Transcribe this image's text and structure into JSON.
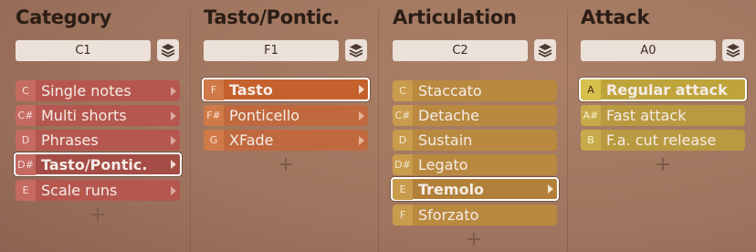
{
  "columns": [
    {
      "title": "Category",
      "key": "C1",
      "items": [
        {
          "note": "C",
          "label": "Single notes"
        },
        {
          "note": "C#",
          "label": "Multi shorts"
        },
        {
          "note": "D",
          "label": "Phrases"
        },
        {
          "note": "D#",
          "label": "Tasto/Pontic."
        },
        {
          "note": "E",
          "label": "Scale runs"
        }
      ],
      "selected_index": 3
    },
    {
      "title": "Tasto/Pontic.",
      "key": "F1",
      "items": [
        {
          "note": "F",
          "label": "Tasto"
        },
        {
          "note": "F#",
          "label": "Ponticello"
        },
        {
          "note": "G",
          "label": "XFade"
        }
      ],
      "selected_index": 0
    },
    {
      "title": "Articulation",
      "key": "C2",
      "items": [
        {
          "note": "C",
          "label": "Staccato"
        },
        {
          "note": "C#",
          "label": "Detache"
        },
        {
          "note": "D",
          "label": "Sustain"
        },
        {
          "note": "D#",
          "label": "Legato"
        },
        {
          "note": "E",
          "label": "Tremolo"
        },
        {
          "note": "F",
          "label": "Sforzato"
        }
      ],
      "selected_index": 4
    },
    {
      "title": "Attack",
      "key": "A0",
      "items": [
        {
          "note": "A",
          "label": "Regular attack"
        },
        {
          "note": "A#",
          "label": "Fast attack"
        },
        {
          "note": "B",
          "label": "F.a. cut release"
        }
      ],
      "selected_index": 0
    }
  ],
  "icons": {
    "layers": "layers-icon",
    "arrow": "chevron-right-icon",
    "add": "plus-icon"
  },
  "colors": {
    "category": "#b5574f",
    "tasto_pontic": "#c0693e",
    "articulation": "#b9893f",
    "attack": "#b89a40",
    "selection_border": "#ffffff"
  }
}
